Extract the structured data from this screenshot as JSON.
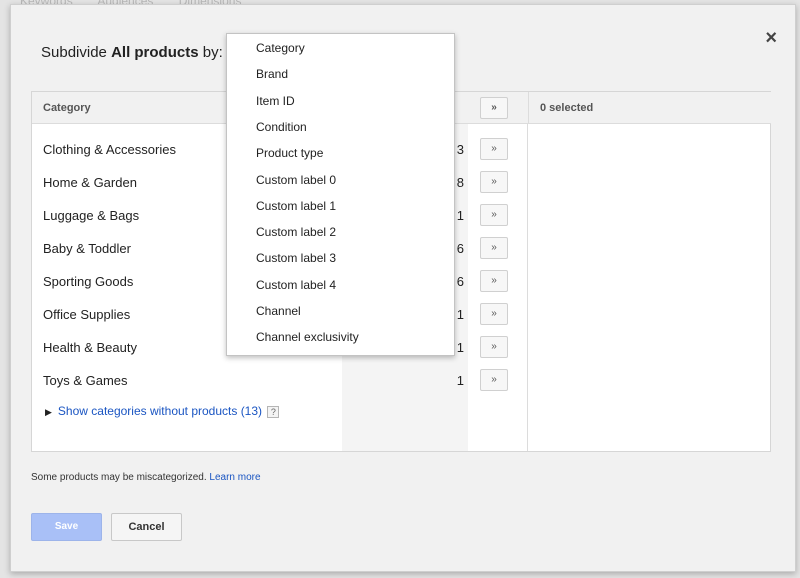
{
  "background_tabs": [
    "Keywords",
    "Audiences",
    "Dimensions"
  ],
  "dialog": {
    "title_prefix": "Subdivide ",
    "title_bold": "All products",
    "title_suffix": " by:",
    "close_glyph": "×"
  },
  "table": {
    "left_header": "Category",
    "right_header": "0 selected",
    "add_glyph": "»",
    "rows": [
      {
        "label": "Clothing & Accessories",
        "count": "3"
      },
      {
        "label": "Home & Garden",
        "count": "8"
      },
      {
        "label": "Luggage & Bags",
        "count": "1"
      },
      {
        "label": "Baby & Toddler",
        "count": "6"
      },
      {
        "label": "Sporting Goods",
        "count": "6"
      },
      {
        "label": "Office Supplies",
        "count": "1"
      },
      {
        "label": "Health & Beauty",
        "count": "1"
      },
      {
        "label": "Toys & Games",
        "count": "1"
      }
    ],
    "show_more": "Show categories without products (13)",
    "help_glyph": "?"
  },
  "dropdown": {
    "options": [
      "Category",
      "Brand",
      "Item ID",
      "Condition",
      "Product type",
      "Custom label 0",
      "Custom label 1",
      "Custom label 2",
      "Custom label 3",
      "Custom label 4",
      "Channel",
      "Channel exclusivity"
    ]
  },
  "footer": {
    "note": "Some products may be miscategorized. ",
    "learn_more": "Learn more",
    "save_label": "Save",
    "cancel_label": "Cancel"
  },
  "colors": {
    "link": "#1a55c2",
    "save_disabled": "#a9c0f7"
  }
}
